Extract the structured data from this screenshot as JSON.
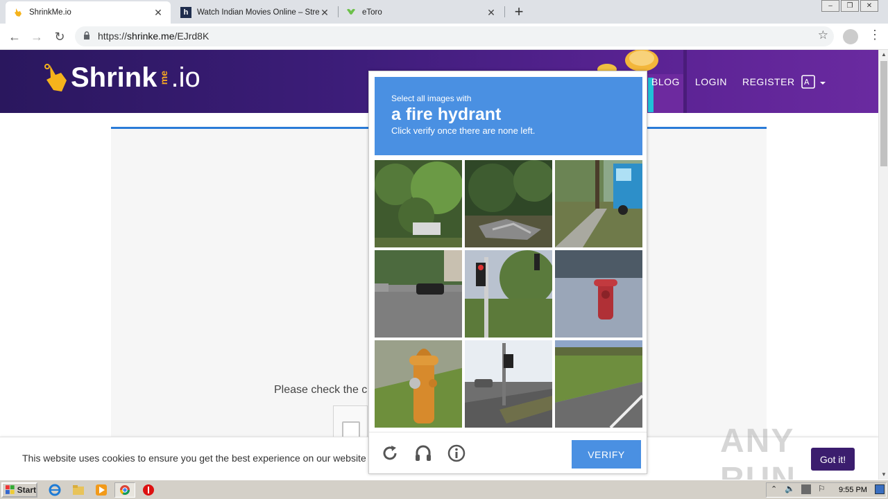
{
  "browser": {
    "tabs": [
      {
        "title": "ShrinkMe.io",
        "favicon": "hand-pointer-icon",
        "active": true
      },
      {
        "title": "Watch Indian Movies Online – Stream",
        "favicon": "h-letter-icon",
        "active": false
      },
      {
        "title": "eToro",
        "favicon": "etoro-bull-icon",
        "active": false
      }
    ],
    "address": {
      "prefix": "https://",
      "host": "shrinke.me",
      "path": "/EJrd8K"
    }
  },
  "site": {
    "logo_main": "Shrink",
    "logo_me": "me",
    "logo_tld": ".io",
    "nav": [
      "BLOG",
      "LOGIN",
      "REGISTER"
    ],
    "check_text": "Please check the c",
    "cookie_text": "This website uses cookies to ensure you get the best experience on our website",
    "gotit_label": "Got it!",
    "watermark": "ANY RUN"
  },
  "captcha": {
    "line1": "Select all images with",
    "target": "a fire hydrant",
    "line3": "Click verify once there are none left.",
    "verify_label": "VERIFY",
    "tiles": [
      "trees-trailer",
      "bushes-debris",
      "truck-street",
      "parking-lot-car",
      "traffic-light-trees",
      "fire-hydrant-red",
      "fire-hydrant-orange",
      "intersection-traffic-light",
      "road-grass"
    ]
  },
  "taskbar": {
    "start_label": "Start",
    "clock": "9:55 PM"
  },
  "colors": {
    "captcha_blue": "#4a90e2",
    "header_purple": "#3d1d7a",
    "gotit_purple": "#3b1d6e"
  }
}
